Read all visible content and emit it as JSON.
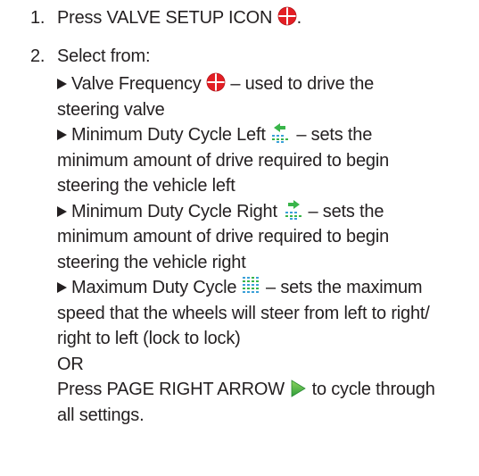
{
  "steps": [
    {
      "number": "1.",
      "text": "Press VALVE SETUP ICON",
      "suffix": "."
    },
    {
      "number": "2.",
      "text": "Select from:"
    }
  ],
  "options": [
    {
      "lines": [
        "Valve Frequency",
        "– used to drive the",
        "steering valve"
      ],
      "icon": "valve-setup-icon"
    },
    {
      "lines": [
        "Minimum Duty Cycle Left",
        "– sets the",
        "minimum amount of drive required to begin",
        "steering the vehicle left"
      ],
      "icon": "min-duty-left-icon"
    },
    {
      "lines": [
        "Minimum Duty Cycle Right",
        "– sets the",
        "minimum amount of drive required to begin",
        "steering the vehicle right"
      ],
      "icon": "min-duty-right-icon"
    },
    {
      "lines": [
        "Maximum Duty Cycle",
        "– sets the maximum",
        "speed that the wheels will steer from left to right/",
        "right to left (lock to lock)"
      ],
      "icon": "max-duty-icon"
    }
  ],
  "or_text": "OR",
  "alternative": {
    "before": "Press PAGE RIGHT ARROW",
    "after": "to cycle through",
    "line2": "all settings.",
    "icon": "page-right-arrow-icon"
  },
  "colors": {
    "text": "#231f20",
    "valve_red": "#e31e24",
    "green": "#39b54a",
    "blue": "#3aa0d8"
  }
}
